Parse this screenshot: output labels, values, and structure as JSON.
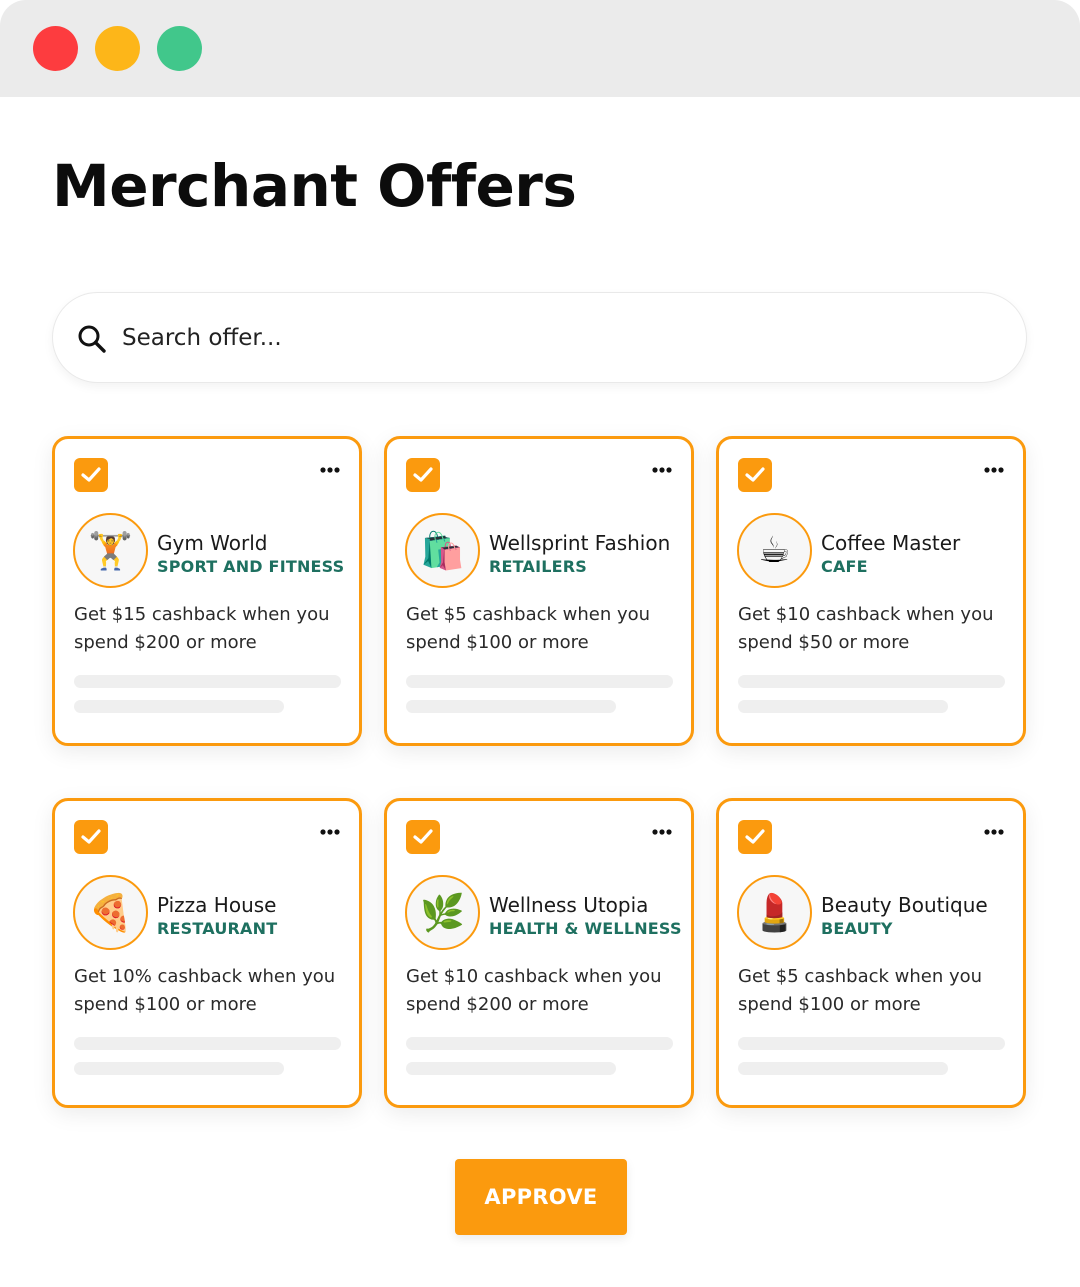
{
  "window": {
    "controls": [
      "close",
      "minimize",
      "maximize"
    ],
    "colors": {
      "close": "#fd3c3f",
      "minimize": "#fdb619",
      "maximize": "#41c78b"
    }
  },
  "page": {
    "title": "Merchant Offers"
  },
  "search": {
    "placeholder": "Search offer...",
    "value": ""
  },
  "offers": [
    {
      "selected": true,
      "icon": "weightlifter-icon",
      "emoji": "🏋️",
      "name": "Gym World",
      "category": "SPORT AND FITNESS",
      "description": "Get $15 cashback when you spend $200 or more"
    },
    {
      "selected": true,
      "icon": "shopping-bags-icon",
      "emoji": "🛍️",
      "name": "Wellsprint Fashion",
      "category": "RETAILERS",
      "description": "Get $5 cashback when you spend $100 or more"
    },
    {
      "selected": true,
      "icon": "coffee-cup-icon",
      "emoji": "☕",
      "name": "Coffee Master",
      "category": "CAFE",
      "description": "Get $10 cashback when you spend $50 or more"
    },
    {
      "selected": true,
      "icon": "pizza-icon",
      "emoji": "🍕",
      "name": "Pizza House",
      "category": "RESTAURANT",
      "description": "Get 10% cashback when you spend $100 or more"
    },
    {
      "selected": true,
      "icon": "herb-icon",
      "emoji": "🌿",
      "name": "Wellness Utopia",
      "category": "HEALTH & WELLNESS",
      "description": "Get $10 cashback when you spend $200 or more"
    },
    {
      "selected": true,
      "icon": "lipstick-icon",
      "emoji": "💄",
      "name": "Beauty Boutique",
      "category": "BEAUTY",
      "description": "Get $5 cashback when you spend $100 or more"
    }
  ],
  "actions": {
    "approve_label": "APPROVE"
  },
  "theme": {
    "accent": "#fb9a0e",
    "category_text": "#1e7060",
    "placeholder_bar": "#efefef"
  }
}
